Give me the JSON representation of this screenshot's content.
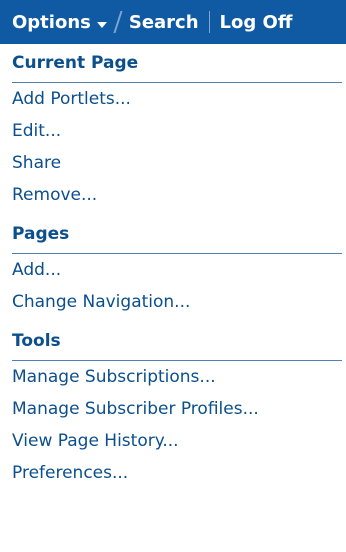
{
  "header": {
    "options_label": "Options",
    "search_label": "Search",
    "logoff_label": "Log Off"
  },
  "sections": [
    {
      "title": "Current Page",
      "items": [
        "Add Portlets...",
        "Edit...",
        "Share",
        "Remove..."
      ]
    },
    {
      "title": "Pages",
      "items": [
        "Add...",
        "Change Navigation..."
      ]
    },
    {
      "title": "Tools",
      "items": [
        "Manage Subscriptions...",
        "Manage Subscriber Profiles...",
        "View Page History...",
        "Preferences..."
      ]
    }
  ],
  "colors": {
    "header_bg": "#0f5aa3",
    "text": "#0b4f8d",
    "rule": "#4f7fb3"
  }
}
